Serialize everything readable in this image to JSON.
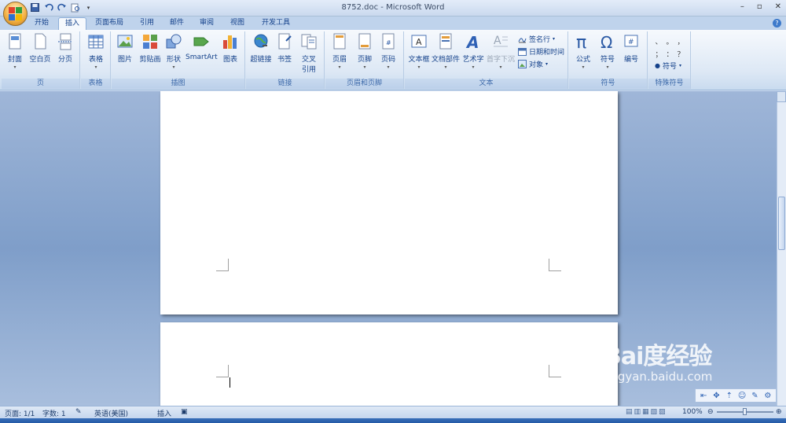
{
  "window": {
    "title": "8752.doc - Microsoft Word",
    "controls": [
      "–",
      "▫",
      "✕"
    ]
  },
  "qat": {
    "icons": [
      "save-icon",
      "undo-icon",
      "redo-icon",
      "print-preview-icon",
      "customize-icon"
    ]
  },
  "tabs": [
    {
      "label": "开始"
    },
    {
      "label": "插入"
    },
    {
      "label": "页面布局"
    },
    {
      "label": "引用"
    },
    {
      "label": "邮件"
    },
    {
      "label": "审阅"
    },
    {
      "label": "视图"
    },
    {
      "label": "开发工具"
    }
  ],
  "ribbon": {
    "groups": {
      "pages": {
        "label": "页",
        "buttons": [
          "封面",
          "空白页",
          "分页"
        ]
      },
      "table": {
        "label": "表格",
        "buttons": [
          "表格"
        ]
      },
      "illustrations": {
        "label": "插图",
        "buttons": [
          "图片",
          "剪贴画",
          "形状",
          "SmartArt",
          "图表"
        ]
      },
      "links": {
        "label": "链接",
        "buttons": [
          "超链接",
          "书签",
          "交叉",
          "引用"
        ]
      },
      "header_footer": {
        "label": "页眉和页脚",
        "buttons": [
          "页眉",
          "页脚",
          "页码"
        ]
      },
      "text": {
        "label": "文本",
        "buttons": [
          "文本框",
          "文档部件",
          "艺术字",
          "首字下沉"
        ],
        "small": [
          "签名行",
          "日期和时间",
          "对象"
        ]
      },
      "symbols": {
        "label": "符号",
        "buttons": [
          "公式",
          "符号",
          "编号"
        ]
      },
      "special": {
        "label": "特殊符号",
        "marks": [
          "、",
          "。",
          "，",
          "；",
          "：",
          "？"
        ],
        "symbol_btn": "符号"
      }
    }
  },
  "statusbar": {
    "page": "页面: 1/1",
    "words": "字数: 1",
    "language": "英语(美国)",
    "mode": "插入",
    "zoom": "100%"
  },
  "watermark": {
    "logo": "Bai度经验",
    "url": "jingyan.baidu.com"
  },
  "colors": {
    "accent": "#15428b",
    "ribbon_bg": "#dde8f5",
    "workspace": "#8aa8d2"
  }
}
